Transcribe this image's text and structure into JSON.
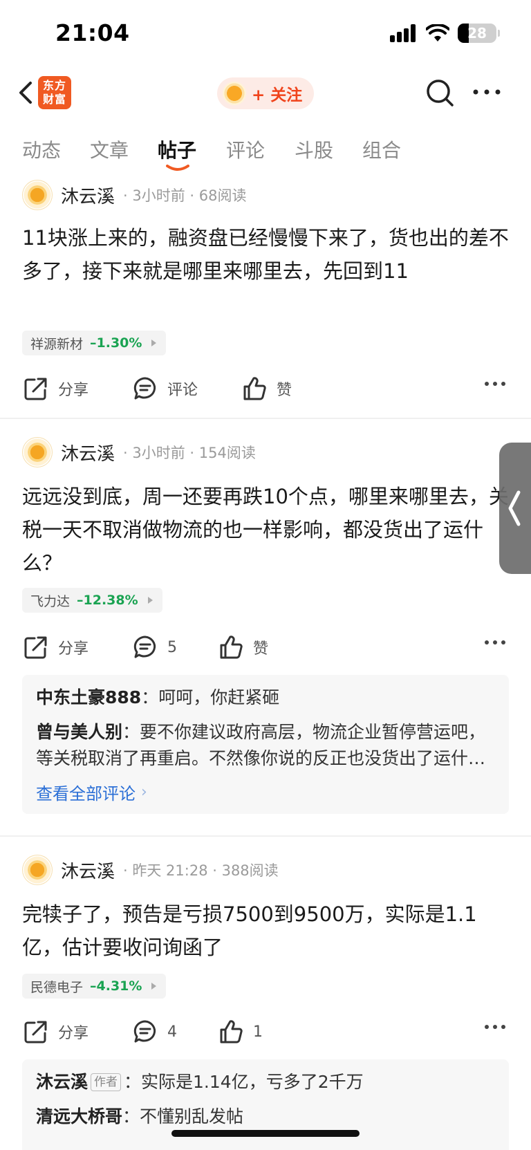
{
  "status_bar": {
    "time": "21:04",
    "battery": "28"
  },
  "nav": {
    "logo_text_line1": "东方",
    "logo_text_line2": "财富",
    "follow_label": "+ 关注"
  },
  "tabs": [
    {
      "label": "动态",
      "active": false
    },
    {
      "label": "文章",
      "active": false
    },
    {
      "label": "帖子",
      "active": true
    },
    {
      "label": "评论",
      "active": false
    },
    {
      "label": "斗股",
      "active": false
    },
    {
      "label": "组合",
      "active": false
    }
  ],
  "colors": {
    "accent": "#f05a22",
    "stock_down": "#1aa352",
    "link": "#2b6fd6"
  },
  "posts": [
    {
      "author": "沐云溪",
      "meta": "· 3小时前 · 68阅读",
      "text": "11块涨上来的，融资盘已经慢慢下来了，货也出的差不多了，接下来就是哪里来哪里去，先回到11",
      "stock": {
        "name": "祥源新材",
        "change": "–1.30%"
      },
      "actions": {
        "share": "分享",
        "comment": "评论",
        "like": "赞"
      }
    },
    {
      "author": "沐云溪",
      "meta": "· 3小时前 · 154阅读",
      "text": "远远没到底，周一还要再跌10个点，哪里来哪里去，关税一天不取消做物流的也一样影响，都没货出了运什么？",
      "stock": {
        "name": "飞力达",
        "change": "–12.38%"
      },
      "actions": {
        "share": "分享",
        "comment": "5",
        "like": "赞"
      },
      "comments": [
        {
          "author": "中东土豪888",
          "sep": "：",
          "text": "呵呵，你赶紧砸"
        },
        {
          "author": "曾与美人别",
          "sep": "：",
          "text": "要不你建议政府高层，物流企业暂停营运吧，等关税取消了再重启。不然像你说的反正也没货出了运什么？"
        }
      ],
      "view_all": "查看全部评论"
    },
    {
      "author": "沐云溪",
      "meta": "· 昨天 21:28 · 388阅读",
      "text": "完犊子了，预告是亏损7500到9500万，实际是1.1亿，估计要收问询函了",
      "stock": {
        "name": "民德电子",
        "change": "–4.31%"
      },
      "actions": {
        "share": "分享",
        "comment": "4",
        "like": "1"
      },
      "comments": [
        {
          "author": "沐云溪",
          "badge": "作者",
          "sep": "：",
          "text": "实际是1.14亿，亏多了2千万"
        },
        {
          "author": "清远大桥哥",
          "sep": "：",
          "text": "不懂别乱发帖"
        }
      ]
    }
  ]
}
